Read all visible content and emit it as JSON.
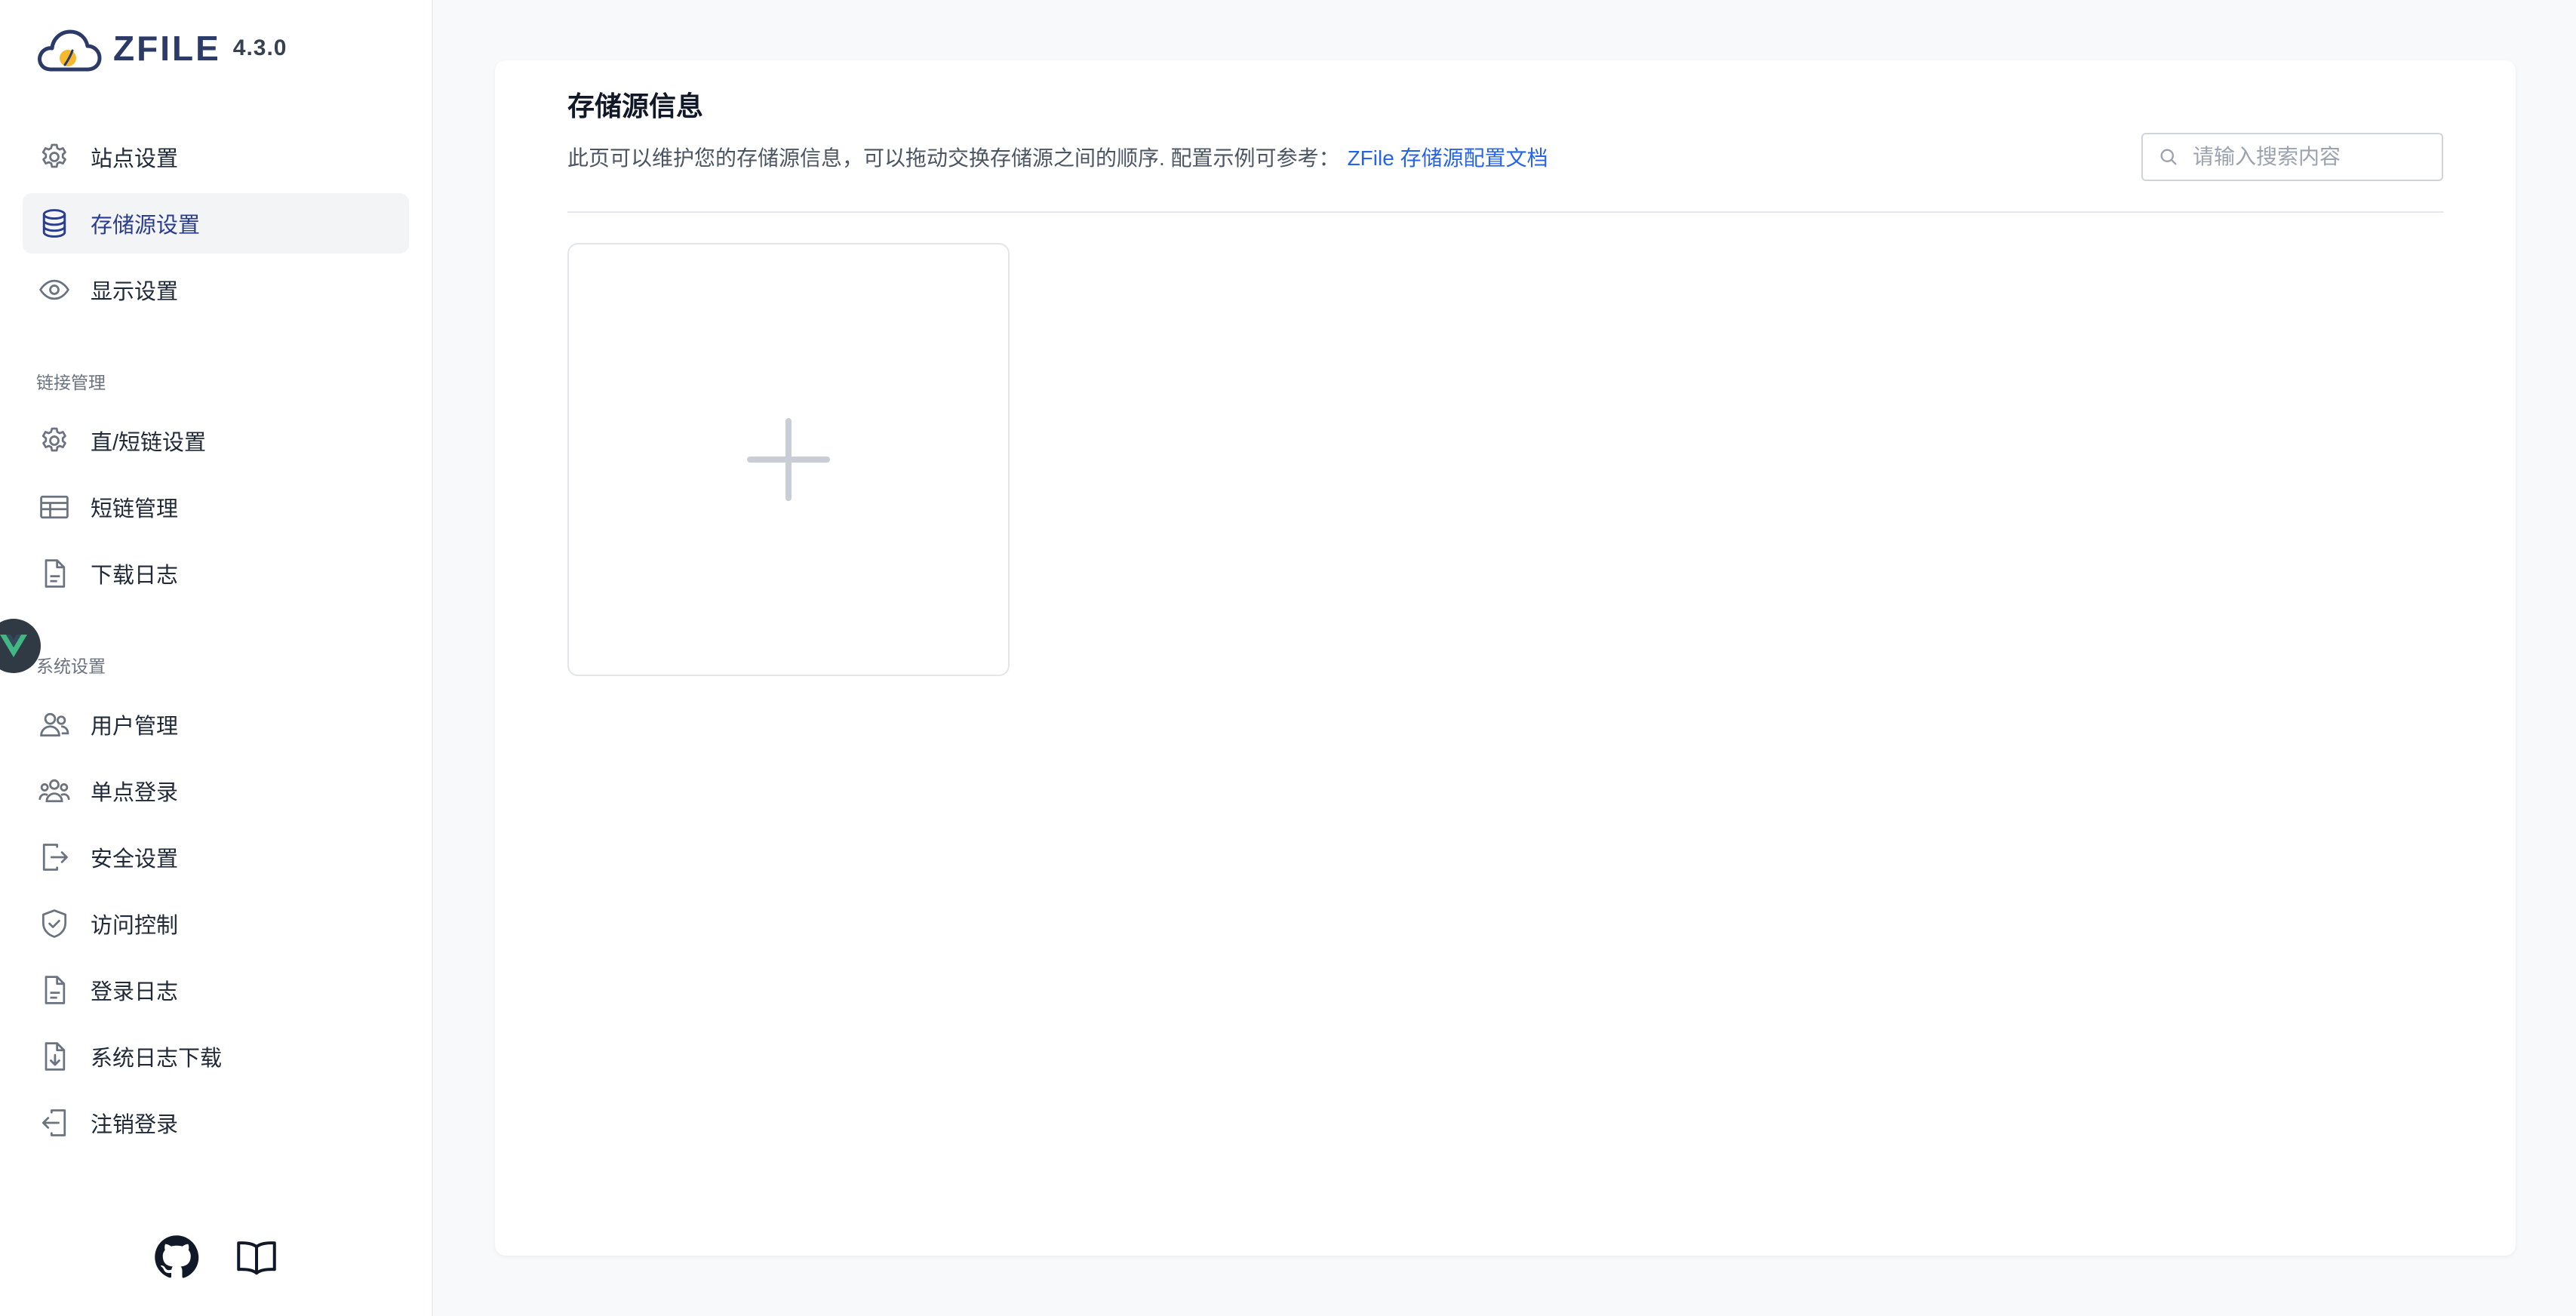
{
  "brand": {
    "name": "ZFILE",
    "version": "4.3.0"
  },
  "sidebar": {
    "items_top": [
      {
        "label": "站点设置",
        "icon": "gear-icon",
        "active": false
      },
      {
        "label": "存储源设置",
        "icon": "database-icon",
        "active": true
      },
      {
        "label": "显示设置",
        "icon": "eye-icon",
        "active": false
      }
    ],
    "section_link": {
      "title": "链接管理",
      "items": [
        {
          "label": "直/短链设置",
          "icon": "gear-icon"
        },
        {
          "label": "短链管理",
          "icon": "table-icon"
        },
        {
          "label": "下载日志",
          "icon": "document-icon"
        }
      ]
    },
    "section_system": {
      "title": "系统设置",
      "items": [
        {
          "label": "用户管理",
          "icon": "users-icon"
        },
        {
          "label": "单点登录",
          "icon": "user-group-icon"
        },
        {
          "label": "安全设置",
          "icon": "logout-icon"
        },
        {
          "label": "访问控制",
          "icon": "shield-check-icon"
        },
        {
          "label": "登录日志",
          "icon": "document-icon"
        },
        {
          "label": "系统日志下载",
          "icon": "document-download-icon"
        },
        {
          "label": "注销登录",
          "icon": "login-icon"
        }
      ]
    },
    "footer": {
      "links": [
        {
          "icon": "github-icon"
        },
        {
          "icon": "book-icon"
        }
      ]
    }
  },
  "main": {
    "title": "存储源信息",
    "description": "此页可以维护您的存储源信息，可以拖动交换存储源之间的顺序. 配置示例可参考：",
    "doc_link": "ZFile 存储源配置文档",
    "search": {
      "placeholder": "请输入搜索内容",
      "value": ""
    }
  },
  "colors": {
    "accent": "#2b3d8f",
    "link": "#2563eb",
    "active_bg": "#f3f4f6"
  }
}
